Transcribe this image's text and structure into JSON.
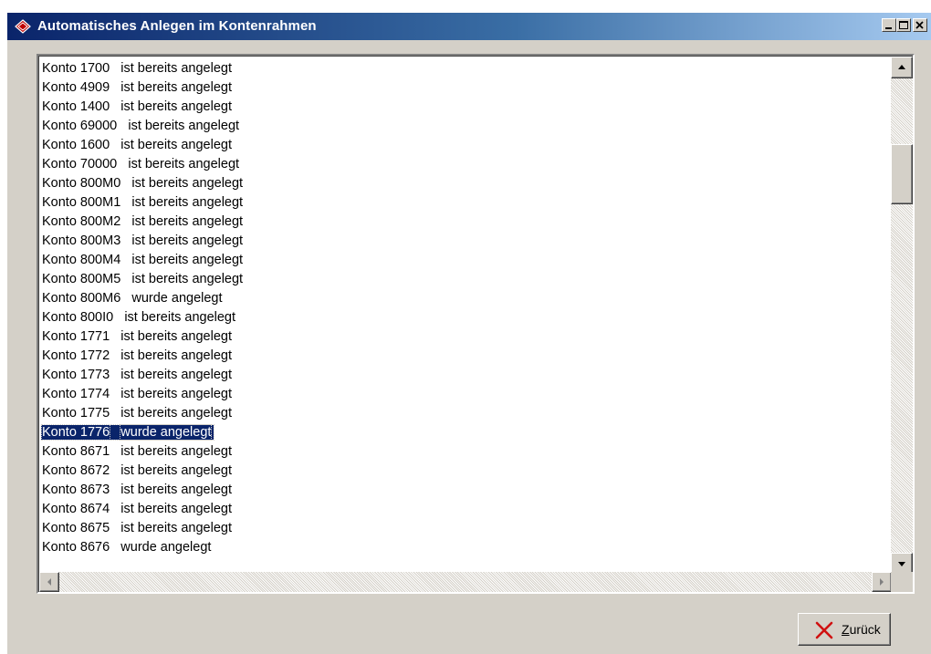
{
  "window": {
    "title": "Automatisches Anlegen im Kontenrahmen",
    "minimize_label": "_",
    "maximize_label": "□",
    "close_label": "X"
  },
  "list": {
    "selected_index": 19,
    "items": [
      {
        "konto": "Konto 1700",
        "status": "ist bereits angelegt"
      },
      {
        "konto": "Konto 4909",
        "status": "ist bereits angelegt"
      },
      {
        "konto": "Konto 1400",
        "status": "ist bereits angelegt"
      },
      {
        "konto": "Konto 69000",
        "status": "ist bereits angelegt"
      },
      {
        "konto": "Konto 1600",
        "status": "ist bereits angelegt"
      },
      {
        "konto": "Konto 70000",
        "status": "ist bereits angelegt"
      },
      {
        "konto": "Konto 800M0",
        "status": "ist bereits angelegt"
      },
      {
        "konto": "Konto 800M1",
        "status": "ist bereits angelegt"
      },
      {
        "konto": "Konto 800M2",
        "status": "ist bereits angelegt"
      },
      {
        "konto": "Konto 800M3",
        "status": "ist bereits angelegt"
      },
      {
        "konto": "Konto 800M4",
        "status": "ist bereits angelegt"
      },
      {
        "konto": "Konto 800M5",
        "status": "ist bereits angelegt"
      },
      {
        "konto": "Konto 800M6",
        "status": "wurde angelegt"
      },
      {
        "konto": "Konto 800I0",
        "status": "ist bereits angelegt"
      },
      {
        "konto": "Konto 1771",
        "status": "ist bereits angelegt"
      },
      {
        "konto": "Konto 1772",
        "status": "ist bereits angelegt"
      },
      {
        "konto": "Konto 1773",
        "status": "ist bereits angelegt"
      },
      {
        "konto": "Konto 1774",
        "status": "ist bereits angelegt"
      },
      {
        "konto": "Konto 1775",
        "status": "ist bereits angelegt"
      },
      {
        "konto": "Konto 1776",
        "status": "wurde angelegt"
      },
      {
        "konto": "Konto 8671",
        "status": "ist bereits angelegt"
      },
      {
        "konto": "Konto 8672",
        "status": "ist bereits angelegt"
      },
      {
        "konto": "Konto 8673",
        "status": "ist bereits angelegt"
      },
      {
        "konto": "Konto 8674",
        "status": "ist bereits angelegt"
      },
      {
        "konto": "Konto 8675",
        "status": "ist bereits angelegt"
      },
      {
        "konto": "Konto 8676",
        "status": "wurde angelegt"
      }
    ]
  },
  "buttons": {
    "back_label": "Zurück",
    "back_icon": "x-cross-icon"
  },
  "colors": {
    "title_start": "#0a246a",
    "title_end": "#a6caf0",
    "selection": "#0a246a",
    "face": "#d4d0c8"
  }
}
